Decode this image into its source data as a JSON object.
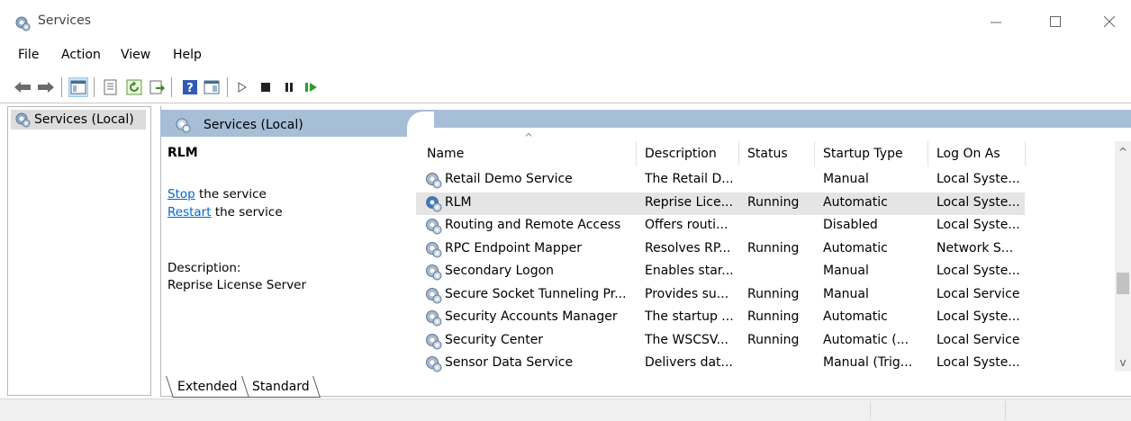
{
  "window": {
    "title": "Services"
  },
  "menu": [
    "File",
    "Action",
    "View",
    "Help"
  ],
  "toolbar_icons": [
    "back-arrow-icon",
    "forward-arrow-icon",
    "show-hide-tree-icon",
    "properties-icon",
    "refresh-icon",
    "export-list-icon",
    "help-icon",
    "console-tree-icon",
    "start-service-icon",
    "stop-service-icon",
    "pause-service-icon",
    "resume-service-icon"
  ],
  "tree": {
    "root_label": "Services (Local)"
  },
  "pane": {
    "title": "Services (Local)"
  },
  "details": {
    "service_name": "RLM",
    "stop_link": "Stop",
    "stop_suffix": " the service",
    "restart_link": "Restart",
    "restart_suffix": " the service",
    "description_label": "Description:",
    "description_text": "Reprise License Server"
  },
  "table": {
    "columns": [
      "Name",
      "Description",
      "Status",
      "Startup Type",
      "Log On As"
    ],
    "rows": [
      {
        "name": "Retail Demo Service",
        "description": "The Retail D...",
        "status": "",
        "startup": "Manual",
        "logon": "Local Syste..."
      },
      {
        "name": "RLM",
        "description": "Reprise Lice...",
        "status": "Running",
        "startup": "Automatic",
        "logon": "Local Syste...",
        "selected": true
      },
      {
        "name": "Routing and Remote Access",
        "description": "Offers routi...",
        "status": "",
        "startup": "Disabled",
        "logon": "Local Syste..."
      },
      {
        "name": "RPC Endpoint Mapper",
        "description": "Resolves RP...",
        "status": "Running",
        "startup": "Automatic",
        "logon": "Network S..."
      },
      {
        "name": "Secondary Logon",
        "description": "Enables star...",
        "status": "",
        "startup": "Manual",
        "logon": "Local Syste..."
      },
      {
        "name": "Secure Socket Tunneling Pr...",
        "description": "Provides su...",
        "status": "Running",
        "startup": "Manual",
        "logon": "Local Service"
      },
      {
        "name": "Security Accounts Manager",
        "description": "The startup ...",
        "status": "Running",
        "startup": "Automatic",
        "logon": "Local Syste..."
      },
      {
        "name": "Security Center",
        "description": "The WSCSV...",
        "status": "Running",
        "startup": "Automatic (...",
        "logon": "Local Service"
      },
      {
        "name": "Sensor Data Service",
        "description": "Delivers dat...",
        "status": "",
        "startup": "Manual (Trig...",
        "logon": "Local Syste..."
      }
    ]
  },
  "tabs": [
    "Extended",
    "Standard"
  ],
  "colors": {
    "header_band": "#a7bed7",
    "link": "#0066cc",
    "selected_row": "#e5e5e5"
  }
}
